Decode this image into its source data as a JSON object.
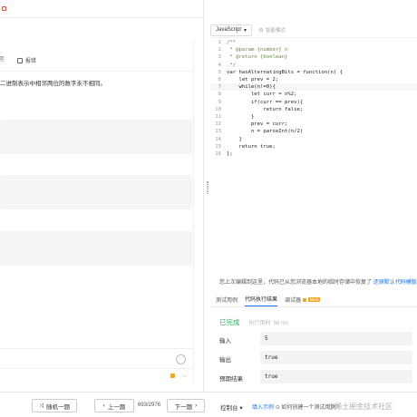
{
  "description": {
    "flag_label": "报错",
    "text": "二进制表示中相邻两位的数字永不相同。"
  },
  "editor": {
    "language": "JavaScript",
    "smart_mode": "智能模式",
    "code": [
      {
        "n": "1",
        "t": "/**"
      },
      {
        "n": "2",
        "t": " * @param {number} n"
      },
      {
        "n": "3",
        "t": " * @return {boolean}"
      },
      {
        "n": "4",
        "t": " */"
      },
      {
        "n": "5",
        "t": "var hasAlternatingBits = function(n) {"
      },
      {
        "n": "6",
        "t": "    let prev = 2;"
      },
      {
        "n": "7",
        "t": "    while(n!=0){"
      },
      {
        "n": "8",
        "t": "        let curr = n%2;"
      },
      {
        "n": "9",
        "t": "        if(curr == prev){"
      },
      {
        "n": "10",
        "t": "            return false;"
      },
      {
        "n": "11",
        "t": "        }"
      },
      {
        "n": "12",
        "t": "        prev = curr;"
      },
      {
        "n": "13",
        "t": "        n = parseInt(n/2)"
      },
      {
        "n": "14",
        "t": "    }"
      },
      {
        "n": "15",
        "t": "    return true;"
      },
      {
        "n": "16",
        "t": "};"
      }
    ]
  },
  "restore": {
    "text": "您上次编辑到这里，代码已从您浏览器本地的临时存储中恢复了",
    "link": "还原默认代码模版"
  },
  "tabs": {
    "testcase": "测试用例",
    "result": "代码执行结果",
    "debugger": "调试器",
    "beta": "Beta"
  },
  "result": {
    "status": "已完成",
    "time": "执行用时: 68 ms",
    "input_label": "输入",
    "input_value": "5",
    "output_label": "输出",
    "output_value": "true",
    "expected_label": "预期结果",
    "expected_value": "true"
  },
  "bottom": {
    "random": "随机一题",
    "prev": "上一题",
    "pager": "693/2976",
    "next": "下一题",
    "console": "控制台",
    "example_link": "填入示例",
    "help": "如何创建一个测试用例?"
  },
  "watermark": "@稀土掘金技术社区",
  "colors": {
    "accent": "#1a73e8",
    "success": "#2db55d",
    "warning": "#f5a623"
  }
}
